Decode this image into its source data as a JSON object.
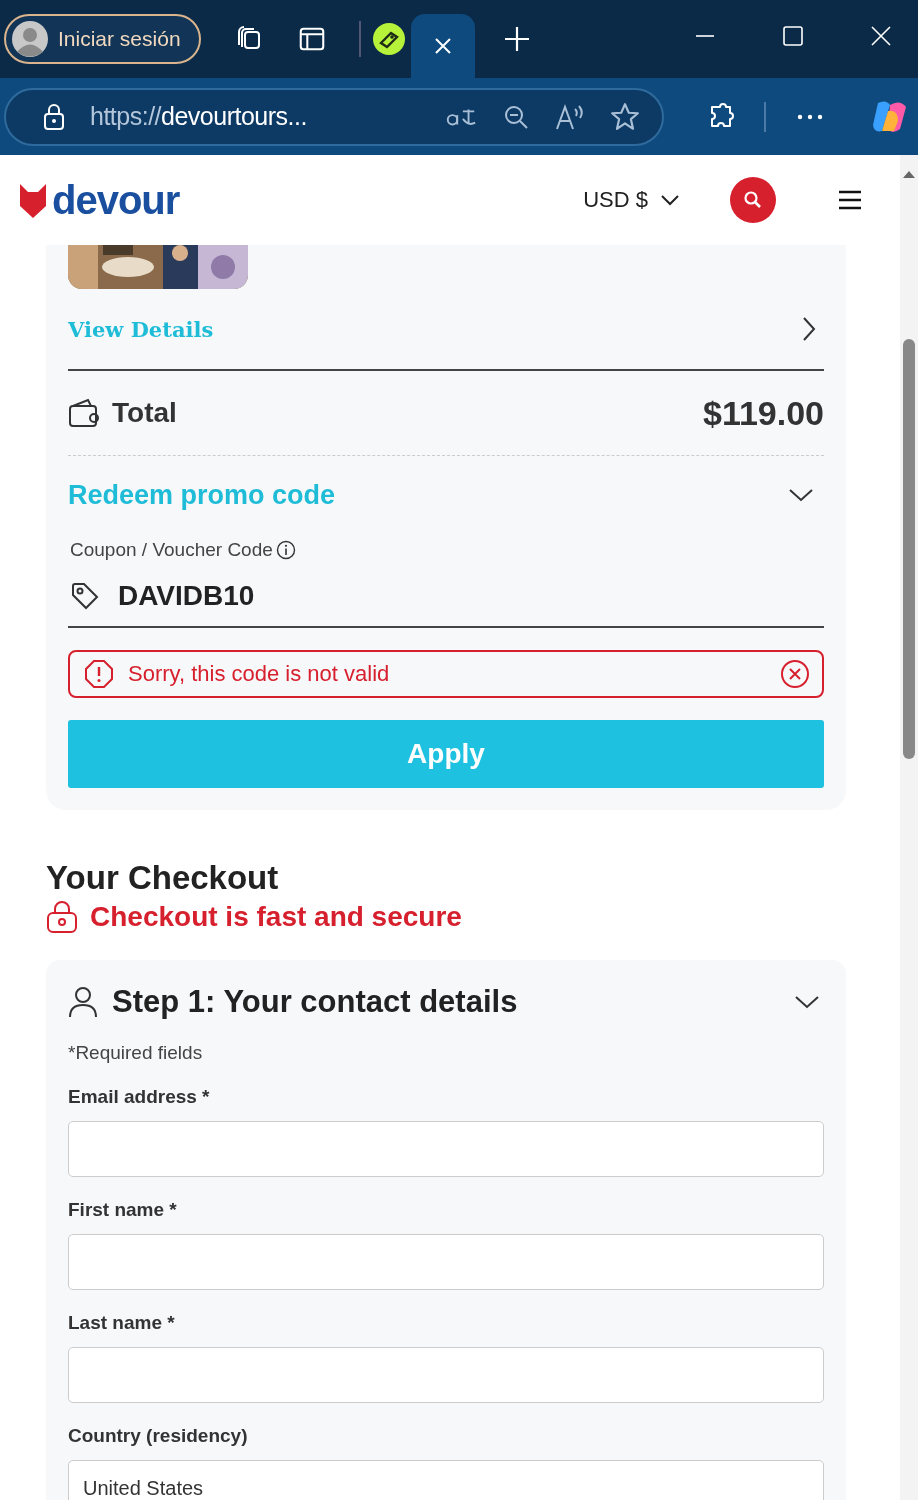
{
  "browser": {
    "profile_label": "Iniciar sesión",
    "url_prefix": "https://",
    "url_host": "devourtours..."
  },
  "site": {
    "logo": "devour",
    "currency": "USD $"
  },
  "summary": {
    "view_details": "View Details",
    "total_label": "Total",
    "total_value": "$119.00"
  },
  "promo": {
    "title": "Redeem promo code",
    "expanded": true,
    "field_label": "Coupon / Voucher Code",
    "code": "DAVIDB10",
    "error": "Sorry, this code is not valid",
    "apply": "Apply"
  },
  "checkout": {
    "title": "Your Checkout",
    "secure_note": "Checkout is fast and secure"
  },
  "step": {
    "title": "Step 1: Your contact details",
    "expanded": true,
    "required_note": "*Required fields",
    "fields": [
      {
        "label": "Email address *"
      },
      {
        "label": "First name *"
      },
      {
        "label": "Last name *"
      },
      {
        "label": "Country (residency)",
        "value": "United States"
      }
    ]
  }
}
